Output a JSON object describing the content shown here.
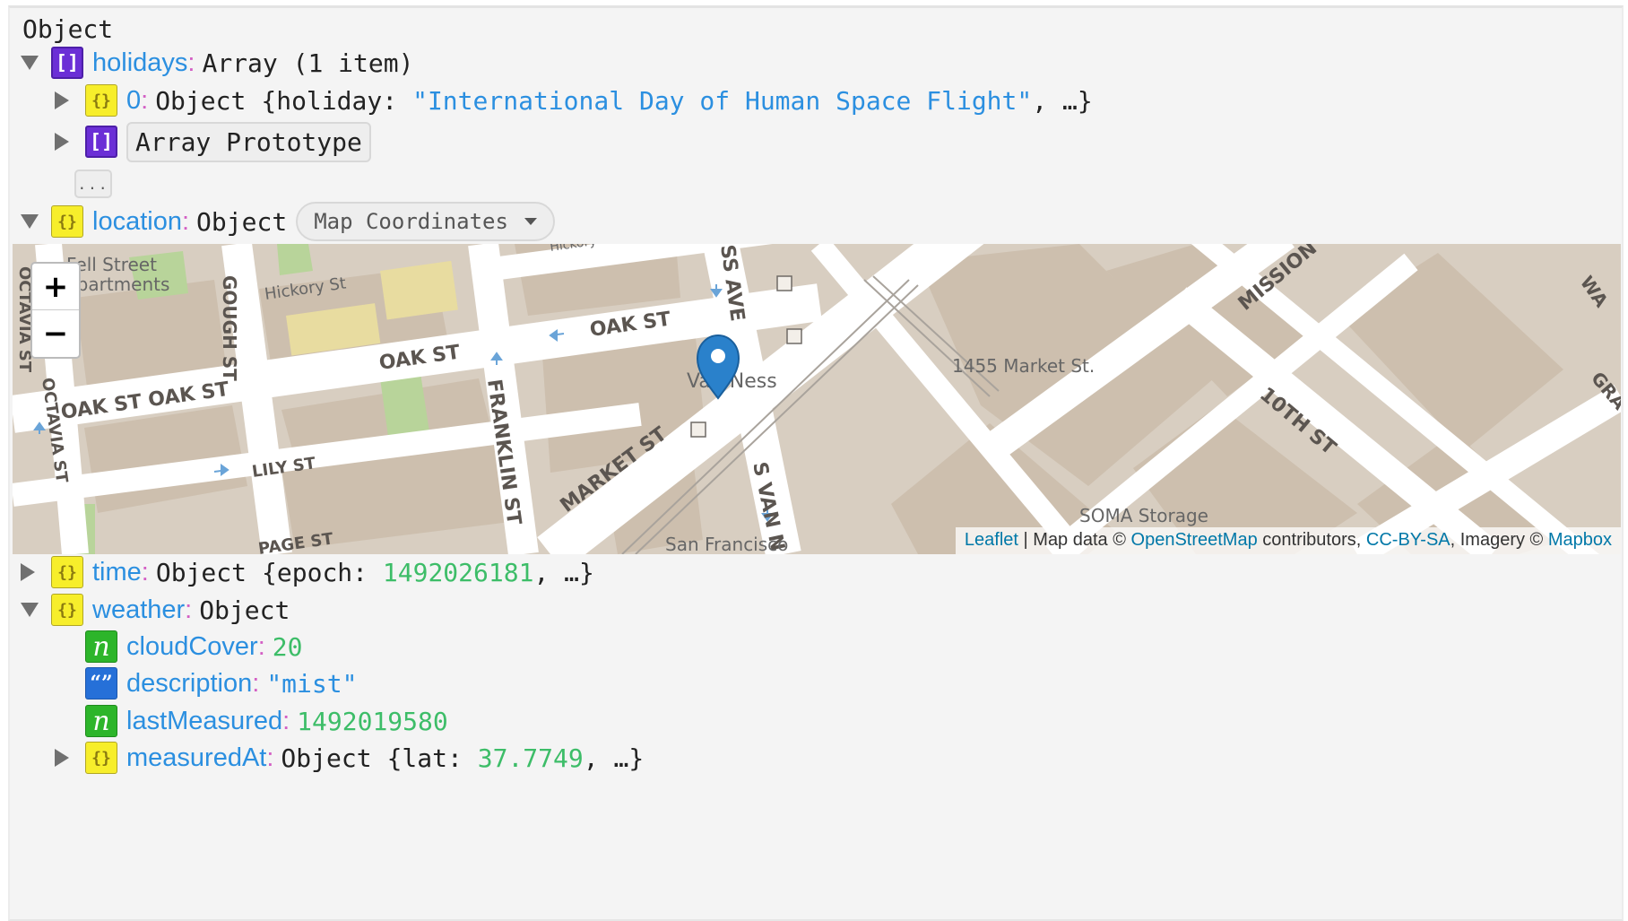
{
  "root": {
    "label": "Object"
  },
  "holidays": {
    "key": "holidays",
    "summary": "Array (1 item)",
    "item0": {
      "key": "0",
      "type": "Object",
      "open_brace": "{",
      "field": "holiday",
      "value": "\"International Day of Human Space Flight\"",
      "rest": ", …}"
    },
    "proto": {
      "label": "Array Prototype"
    },
    "more": "..."
  },
  "location": {
    "key": "location",
    "summary": "Object",
    "visualizer": {
      "label": "Map Coordinates"
    },
    "map": {
      "zoom_in": "+",
      "zoom_out": "−",
      "labels": {
        "fell": "Fell Street",
        "apartments": "Apartments",
        "hickory": "Hickory St",
        "hickory_top": "Hickory",
        "gough": "GOUGH ST",
        "octavia_top": "OCTAVIA ST",
        "octavia_bottom": "OCTAVIA ST",
        "oak_left": "OAK ST OAK ST",
        "oak_mid": "OAK ST",
        "oak_right": "OAK ST",
        "lily": "LILY ST",
        "page": "PAGE ST",
        "franklin": "FRANKLIN ST",
        "market": "MARKET ST",
        "ness_ave": "SS AVE",
        "van_ness": "Van Ness",
        "s_van_ness": "S VAN N",
        "market_1455": "1455 Market St.",
        "mission": "MISSION",
        "tenth": "10TH ST",
        "soma": "SOMA Storage",
        "sf": "San Francisco",
        "wa": "WA",
        "gra": "GRA"
      },
      "attribution": {
        "leaflet": "Leaflet",
        "sep": " | Map data © ",
        "osm": "OpenStreetMap",
        "contrib": " contributors, ",
        "license": "CC-BY-SA",
        "imagery": ", Imagery © ",
        "mapbox": "Mapbox"
      }
    }
  },
  "time": {
    "key": "time",
    "type": "Object",
    "open": "{epoch: ",
    "value": "1492026181",
    "rest": ", …}"
  },
  "weather": {
    "key": "weather",
    "summary": "Object",
    "cloudCover": {
      "key": "cloudCover",
      "value": "20"
    },
    "description": {
      "key": "description",
      "value": "\"mist\""
    },
    "lastMeasured": {
      "key": "lastMeasured",
      "value": "1492019580"
    },
    "measuredAt": {
      "key": "measuredAt",
      "type": "Object",
      "open": "{lat: ",
      "value": "37.7749",
      "rest": ", …}"
    }
  },
  "icons": {
    "array": "[]",
    "object": "{}",
    "number": "n",
    "string": "“”"
  },
  "colors": {
    "key": "#2b8fe0",
    "number": "#3dbd68",
    "colon": "#d35ec4",
    "array_badge": "#6b2fd6",
    "object_badge": "#f7ee2b"
  }
}
